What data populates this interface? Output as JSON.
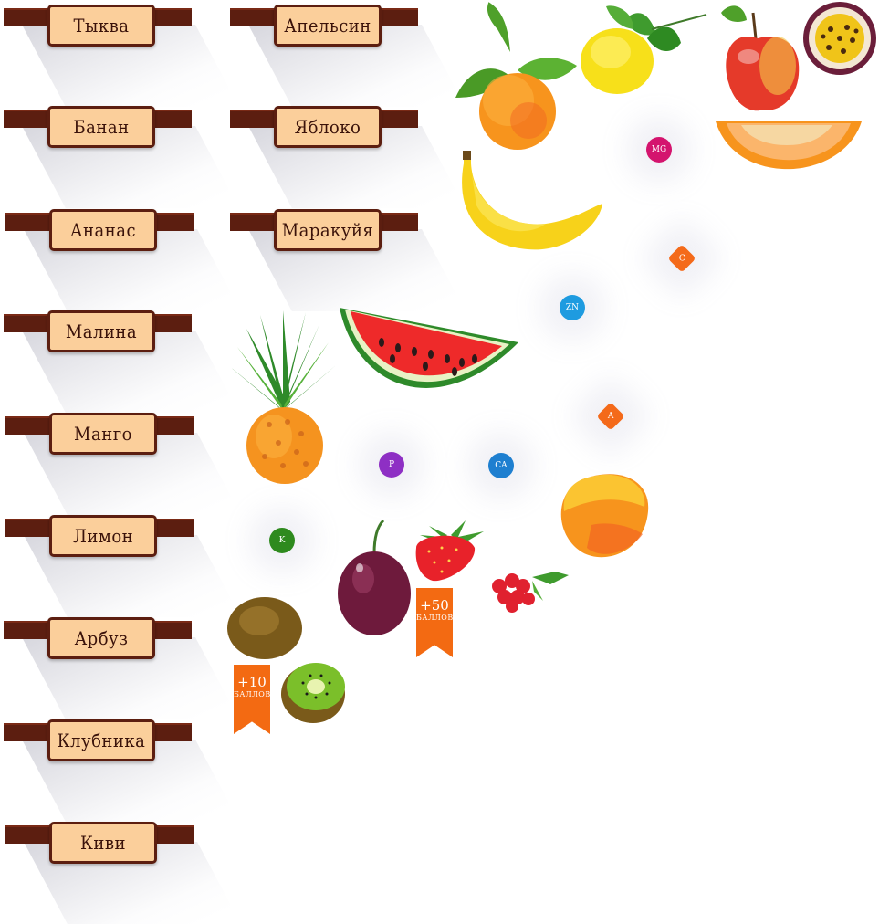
{
  "labels_left": [
    "Тыква",
    "Банан",
    "Ананас",
    "Малина",
    "Манго",
    "Лимон",
    "Арбуз",
    "Клубника",
    "Киви"
  ],
  "labels_right": [
    "Апельсин",
    "Яблоко",
    "Маракуйя"
  ],
  "badges": {
    "mg": "MG",
    "c": "C",
    "zn": "ZN",
    "a": "A",
    "p": "P",
    "ca": "CA",
    "k": "K"
  },
  "ribbons": {
    "r10": {
      "points": "+10",
      "unit": "БАЛЛОВ"
    },
    "r50": {
      "points": "+50",
      "unit": "БАЛЛОВ"
    }
  },
  "colors": {
    "wood": "#5c1e10",
    "plate": "#fbcf9b",
    "ribbon": "#f36a12"
  }
}
